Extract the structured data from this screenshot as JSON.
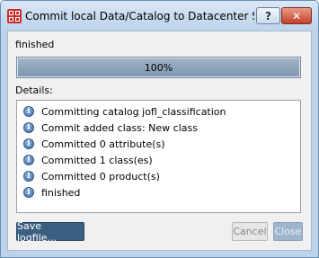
{
  "window": {
    "title": "Commit local Data/Catalog to Datacenter Ser...",
    "help_label": "?",
    "close_label": "✕"
  },
  "status": {
    "text": "finished"
  },
  "progress": {
    "label": "100%",
    "value": 100
  },
  "details": {
    "label": "Details:",
    "entries": [
      {
        "icon": "info-icon",
        "text": "Committing catalog jofl_classification"
      },
      {
        "icon": "info-icon",
        "text": "Commit added class: New class"
      },
      {
        "icon": "info-icon",
        "text": "Committed 0 attribute(s)"
      },
      {
        "icon": "info-icon",
        "text": "Committed 1 class(es)"
      },
      {
        "icon": "info-icon",
        "text": "Committed 0 product(s)"
      },
      {
        "icon": "info-icon",
        "text": "finished"
      }
    ]
  },
  "buttons": {
    "save_logfile": "Save logfile...",
    "cancel": "Cancel",
    "close": "Close"
  }
}
